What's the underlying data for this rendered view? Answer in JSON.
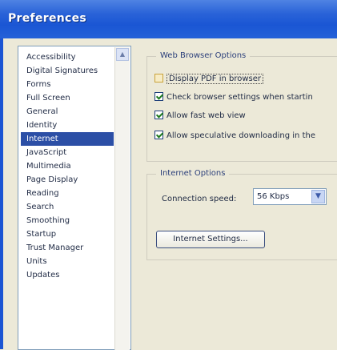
{
  "window": {
    "title": "Preferences"
  },
  "categories": {
    "items": [
      "Accessibility",
      "Digital Signatures",
      "Forms",
      "Full Screen",
      "General",
      "Identity",
      "Internet",
      "JavaScript",
      "Multimedia",
      "Page Display",
      "Reading",
      "Search",
      "Smoothing",
      "Startup",
      "Trust Manager",
      "Units",
      "Updates"
    ],
    "selected": "Internet"
  },
  "web_browser_options": {
    "title": "Web Browser Options",
    "display_pdf": {
      "label": "Display PDF in browser",
      "checked": false
    },
    "check_settings": {
      "label": "Check browser settings when startin",
      "checked": true
    },
    "fast_web_view": {
      "label": "Allow fast web view",
      "checked": true
    },
    "speculative": {
      "label": "Allow speculative downloading in the",
      "checked": true
    }
  },
  "internet_options": {
    "title": "Internet Options",
    "connection_speed_label": "Connection speed:",
    "connection_speed_value": "56 Kbps",
    "settings_button": "Internet Settings..."
  },
  "icons": {
    "dropdown": "chevron-down-icon",
    "scroll_up": "arrow-up-icon"
  },
  "colors": {
    "title_bar": "#1a56d4",
    "selection": "#2c4fa6"
  }
}
